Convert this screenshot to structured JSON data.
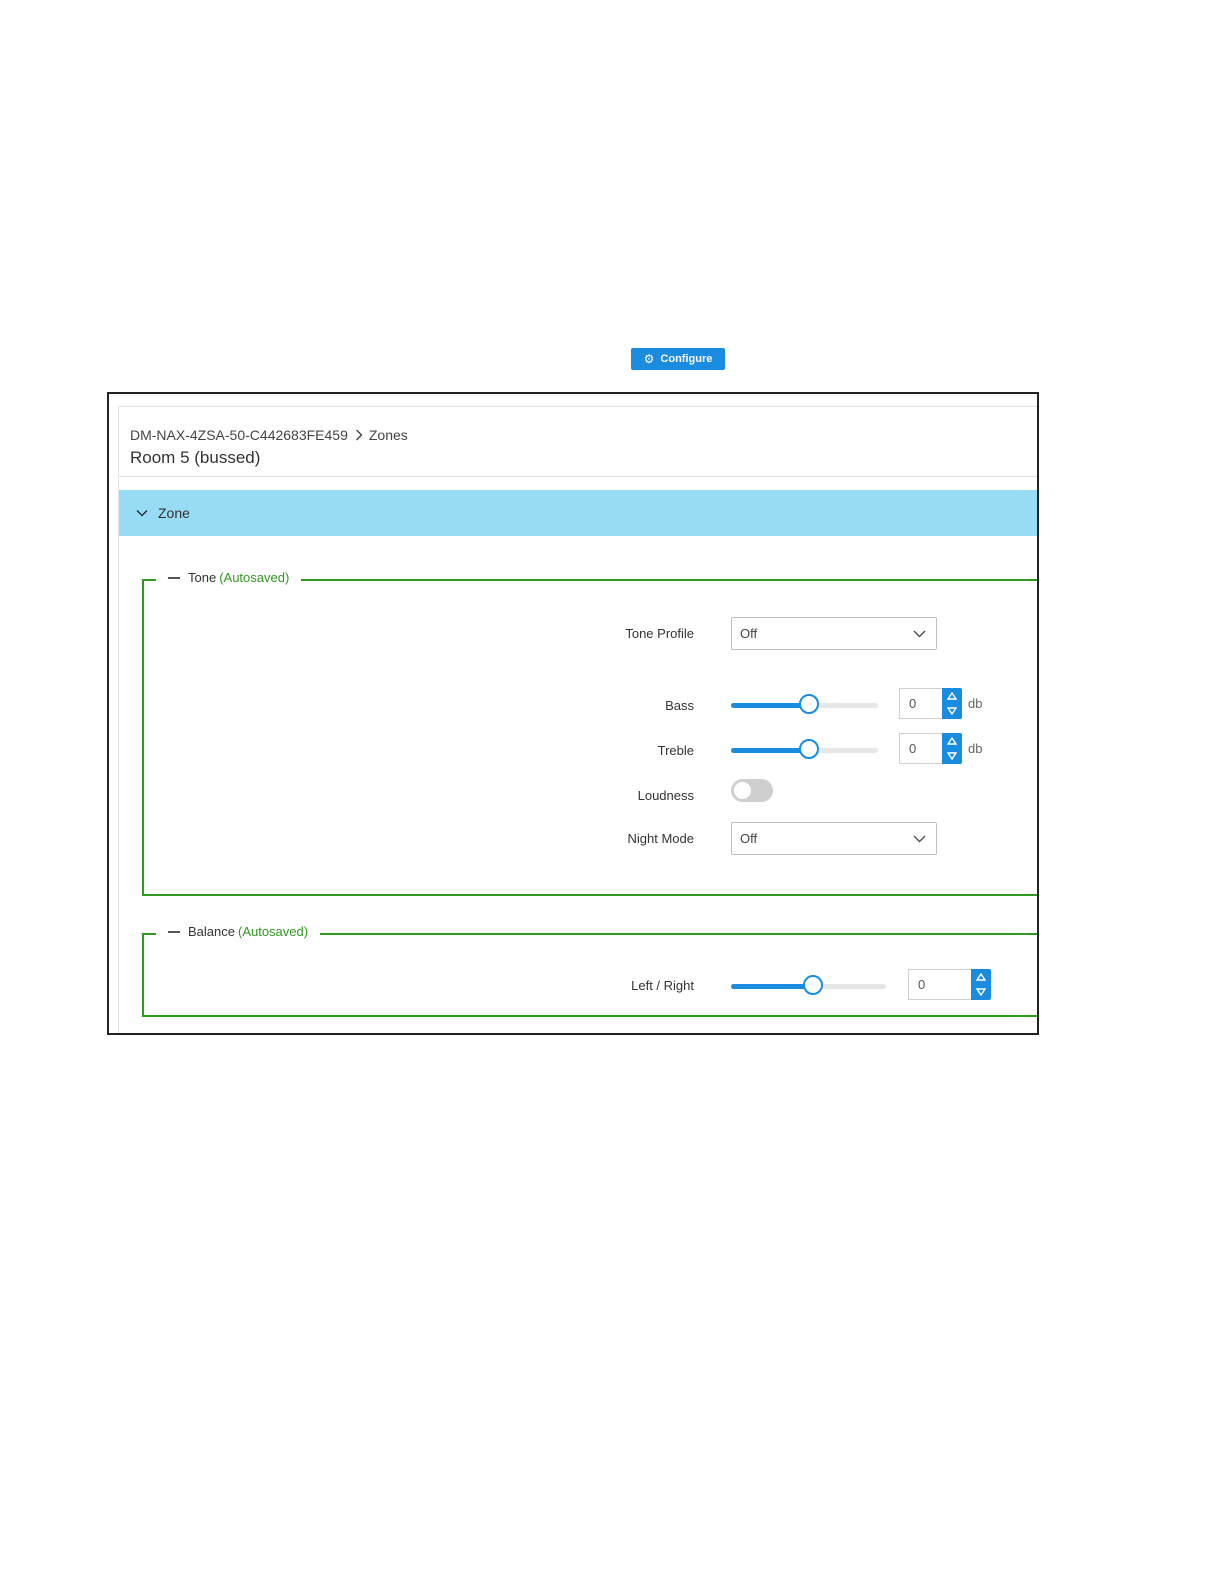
{
  "toolbar": {
    "configure_label": "Configure",
    "configure_icon": "gear-icon"
  },
  "breadcrumb": {
    "device": "DM-NAX-4ZSA-50-C442683FE459",
    "section": "Zones"
  },
  "page": {
    "title": "Room 5 (bussed)"
  },
  "zone": {
    "label": "Zone",
    "expanded": true
  },
  "tone": {
    "legend": "Tone",
    "autosaved": "(Autosaved)",
    "tone_profile": {
      "label": "Tone Profile",
      "value": "Off"
    },
    "bass": {
      "label": "Bass",
      "value": "0",
      "unit": "db",
      "slider_level": 0.53
    },
    "treble": {
      "label": "Treble",
      "value": "0",
      "unit": "db",
      "slider_level": 0.53
    },
    "loudness": {
      "label": "Loudness",
      "on": false
    },
    "night_mode": {
      "label": "Night Mode",
      "value": "Off"
    }
  },
  "balance": {
    "legend": "Balance",
    "autosaved": "(Autosaved)",
    "left_right": {
      "label": "Left / Right",
      "value": "0",
      "slider_level": 0.53
    }
  },
  "colors": {
    "accent": "#1a8ce0",
    "zone_bar": "#97dbf5",
    "autosaved": "#2e9a1e",
    "fieldset_border": "#2e9a1e"
  }
}
